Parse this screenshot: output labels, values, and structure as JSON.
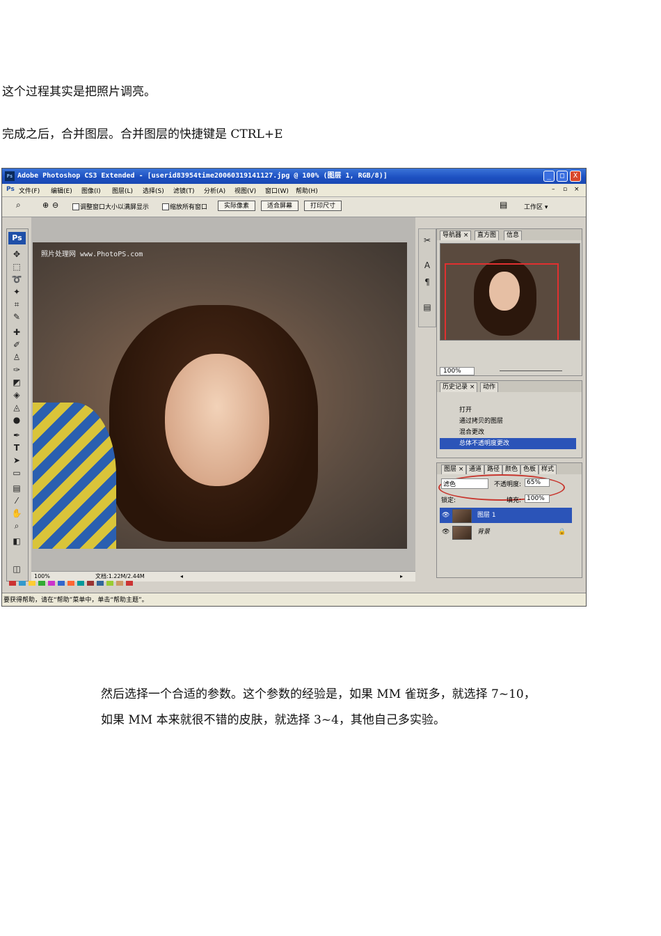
{
  "doc": {
    "para1": "这个过程其实是把照片调亮。",
    "para2": "完成之后，合并图层。合并图层的快捷键是  CTRL+E",
    "para3": "然后选择一个合适的参数。这个参数的经验是，如果 MM 雀斑多，就选择 7~10，",
    "para4": "如果 MM 本来就很不错的皮肤，就选择 3~4，其他自己多实验。"
  },
  "photoshop": {
    "app_icon": "Ps",
    "title": "Adobe Photoshop CS3 Extended - [userid83954time20060319141127.jpg @ 100% (图层 1, RGB/8)]",
    "window_buttons": {
      "minimize": "_",
      "maximize": "□",
      "close": "X"
    },
    "menu": [
      "文件(F)",
      "编辑(E)",
      "图像(I)",
      "图层(L)",
      "选择(S)",
      "滤镜(T)",
      "分析(A)",
      "视图(V)",
      "窗口(W)",
      "帮助(H)"
    ],
    "options": {
      "check1": "调整窗口大小以满屏显示",
      "check2": "缩放所有窗口",
      "btn_actual": "实际像素",
      "btn_fit": "适合屏幕",
      "btn_print": "打印尺寸",
      "workspace": "工作区 ▾"
    },
    "toolbox_logo": "Ps",
    "canvas": {
      "watermark": "照片处理网 www.PhotoPS.com",
      "zoom": "100%",
      "doc_size": "文档:1.22M/2.44M"
    },
    "navigator": {
      "tabs": [
        "导航器 ×",
        "直方图",
        "信息"
      ],
      "zoom": "100%"
    },
    "history": {
      "tabs": [
        "历史记录 ×",
        "动作"
      ],
      "items": [
        "打开",
        "通过拷贝的图层",
        "混合更改",
        "总体不透明度更改"
      ],
      "selected_index": 3
    },
    "layers": {
      "tabs": [
        "图层 ×",
        "通道",
        "路径",
        "颜色",
        "色板",
        "样式"
      ],
      "blend_mode": "滤色",
      "opacity_label": "不透明度:",
      "opacity_value": "65%",
      "lock_label": "锁定:",
      "fill_label": "填充:",
      "fill_value": "100%",
      "items": [
        "图层 1",
        "背景"
      ],
      "selected_index": 0
    },
    "help_text": "要获得帮助，请在“帮助”菜单中，单击“帮助主题”。"
  }
}
